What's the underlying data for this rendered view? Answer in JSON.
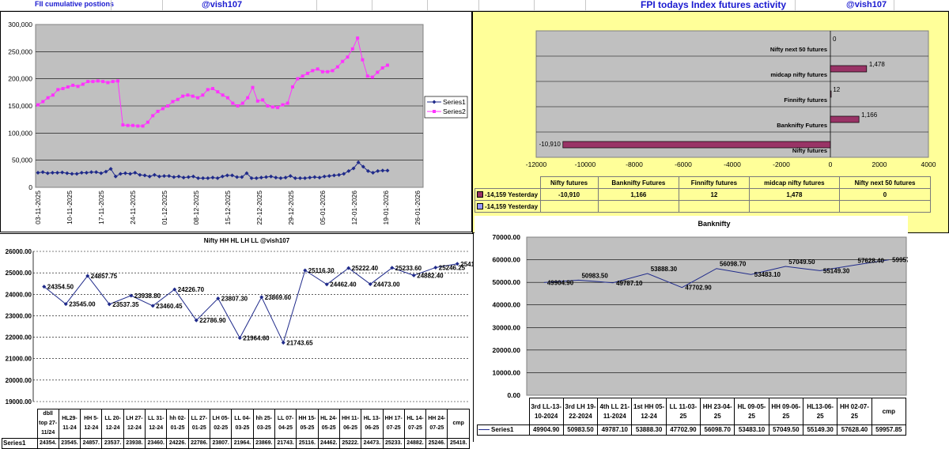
{
  "header": {
    "fii_title": "FII cumulative postions",
    "handle_left": "@vish107",
    "fpi_title": "FPI todays Index futures activity",
    "handle_right": "@vish107"
  },
  "colors": {
    "series1": "#1f2a8a",
    "series2": "#ff33ff",
    "plot_gray": "#c0c0c0",
    "fpi_bg": "#ffff99",
    "fpi_bar": "#993366",
    "fpi_bar2": "#9999ff",
    "nifty_line": "#1f2a8a"
  },
  "chart_data": [
    {
      "id": "fii",
      "type": "line",
      "title": "",
      "xlabel": "",
      "ylabel": "",
      "ylim": [
        0,
        300000
      ],
      "yticks": [
        "0",
        "50,000",
        "100,000",
        "150,000",
        "200,000",
        "250,000",
        "300,000"
      ],
      "categories": [
        "03-11-2025",
        "10-11-2025",
        "17-11-2025",
        "24-11-2025",
        "01-12-2025",
        "08-12-2025",
        "15-12-2025",
        "22-12-2025",
        "29-12-2025",
        "05-01-2026",
        "12-01-2026",
        "19-01-2026",
        "26-01-2026"
      ],
      "grid": true,
      "legend": "right",
      "series": [
        {
          "name": "Series1",
          "values": [
            27000,
            28000,
            26000,
            27000,
            27000,
            27500,
            26000,
            25000,
            25000,
            27000,
            27000,
            28000,
            28000,
            26000,
            29000,
            34000,
            20000,
            25000,
            26000,
            25000,
            27000,
            23000,
            22000,
            20000,
            23000,
            20000,
            21000,
            21000,
            19000,
            20000,
            18000,
            19000,
            20000,
            17000,
            17000,
            17000,
            18000,
            17000,
            20000,
            22000,
            22000,
            19000,
            19000,
            26000,
            17000,
            17000,
            18000,
            19000,
            20000,
            18000,
            17000,
            18000,
            21000,
            17000,
            17000,
            17000,
            18000,
            19000,
            18000,
            20000,
            21000,
            22000,
            23000,
            25000,
            30000,
            35000,
            46000,
            38000,
            30000,
            27000,
            30000,
            31000,
            31000
          ]
        },
        {
          "name": "Series2",
          "values": [
            152000,
            158000,
            165000,
            170000,
            180000,
            182000,
            185000,
            188000,
            186000,
            190000,
            195000,
            195000,
            196000,
            195000,
            193000,
            195000,
            196000,
            115000,
            114000,
            114000,
            113000,
            113000,
            120000,
            132000,
            140000,
            145000,
            150000,
            158000,
            162000,
            168000,
            170000,
            168000,
            165000,
            170000,
            180000,
            182000,
            176000,
            170000,
            165000,
            155000,
            150000,
            155000,
            165000,
            184000,
            159000,
            161000,
            150000,
            148000,
            147000,
            152000,
            155000,
            185000,
            200000,
            205000,
            210000,
            215000,
            218000,
            213000,
            213000,
            215000,
            222000,
            232000,
            240000,
            255000,
            275000,
            235000,
            205000,
            203000,
            212000,
            220000,
            225000
          ]
        }
      ]
    },
    {
      "id": "fpi",
      "type": "bar",
      "orientation": "horizontal",
      "categories": [
        "Nifty futures",
        "Banknifty Futures",
        "Finnifty futures",
        "midcap nifty futures",
        "Nifty next 50 futures"
      ],
      "series": [
        {
          "name": "-14,159 Yesterday",
          "values": [
            -10910,
            1166,
            12,
            1478,
            0
          ],
          "labels": [
            "-10,910",
            "1,166",
            "12",
            "1,478",
            "0"
          ]
        },
        {
          "name": "-14,159 Yesterday",
          "values": [
            null,
            null,
            null,
            null,
            null
          ],
          "labels": [
            "",
            "",
            "",
            "",
            ""
          ]
        }
      ],
      "xlim": [
        -12000,
        4000
      ],
      "xticks": [
        "-12000",
        "-10000",
        "-8000",
        "-6000",
        "-4000",
        "-2000",
        "0",
        "2000",
        "4000"
      ],
      "table_values": [
        "-10,910",
        "1,166",
        "12",
        "1,478",
        "0"
      ]
    },
    {
      "id": "nifty",
      "type": "line",
      "title": "Nifty HH HL LH LL          @vish107",
      "ylim": [
        19000,
        26000
      ],
      "yticks": [
        "19000.00",
        "20000.00",
        "21000.00",
        "22000.00",
        "23000.00",
        "24000.00",
        "25000.00",
        "26000.00"
      ],
      "categories": [
        "dbll top 27-11/24",
        "HL29-11-24",
        "HH 5-12-24",
        "LL 20-12-24",
        "LH 27-12-24",
        "LL 31-12-24",
        "hh 02-01-25",
        "LL 27-01-25",
        "LH 05-02-25",
        "LL 04-03-25",
        "hh 25-03-25",
        "LL 07-04-25",
        "HH 15-05-25",
        "HL 24-05-25",
        "HH 11-06-25",
        "HL 13-06-25",
        "HH 17-07-25",
        "HL 14-07-25",
        "HH 24-07-25",
        "cmp"
      ],
      "series": [
        {
          "name": "Series1",
          "values": [
            24354.5,
            23545.0,
            24857.75,
            23537.35,
            23938.8,
            23460.45,
            24226.7,
            22786.9,
            23807.3,
            21964.6,
            23869.6,
            21743.65,
            25116.3,
            24462.4,
            25222.4,
            24473.0,
            25233.6,
            24882.4,
            25246.25,
            25418.9
          ],
          "labels": [
            "24354.50",
            "23545.00",
            "24857.75",
            "23537.35",
            "23938.80",
            "23460.45",
            "24226.70",
            "22786.90",
            "23807.30",
            "21964.60",
            "23869.60",
            "21743.65",
            "25116.30",
            "24462.40",
            "25222.40",
            "24473.00",
            "25233.60",
            "24882.40",
            "25246.25",
            "25418.9"
          ],
          "table": [
            "24354.",
            "23545.",
            "24857.",
            "23537.",
            "23938.",
            "23460.",
            "24226.",
            "22786.",
            "23807.",
            "21964.",
            "23869.",
            "21743.",
            "25116.",
            "24462.",
            "25222.",
            "24473.",
            "25233.",
            "24882.",
            "25246.",
            "25418."
          ]
        }
      ]
    },
    {
      "id": "banknifty",
      "type": "line",
      "title": "Banknifty",
      "ylim": [
        0,
        70000
      ],
      "yticks": [
        "0.00",
        "10000.00",
        "20000.00",
        "30000.00",
        "40000.00",
        "50000.00",
        "60000.00",
        "70000.00"
      ],
      "categories": [
        "3rd LL-13-10-2024",
        "3rd LH 19-22-2024",
        "4th LL 21-11-2024",
        "1st HH 05-12-24",
        "LL 11-03-25",
        "HH 23-04-25",
        "HL 09-05-25",
        "HH 09-06-25",
        "HL13-06-25",
        "HH 02-07-25",
        "cmp"
      ],
      "series": [
        {
          "name": "Series1",
          "values": [
            49904.9,
            50983.5,
            49787.1,
            53888.3,
            47702.9,
            56098.7,
            53483.1,
            57049.5,
            55149.3,
            57628.4,
            59957.85
          ],
          "labels": [
            "49904.90",
            "50983.50",
            "49787.10",
            "53888.30",
            "47702.90",
            "56098.70",
            "53483.10",
            "57049.50",
            "55149.30",
            "57628.40",
            "59957.85"
          ]
        }
      ]
    }
  ]
}
